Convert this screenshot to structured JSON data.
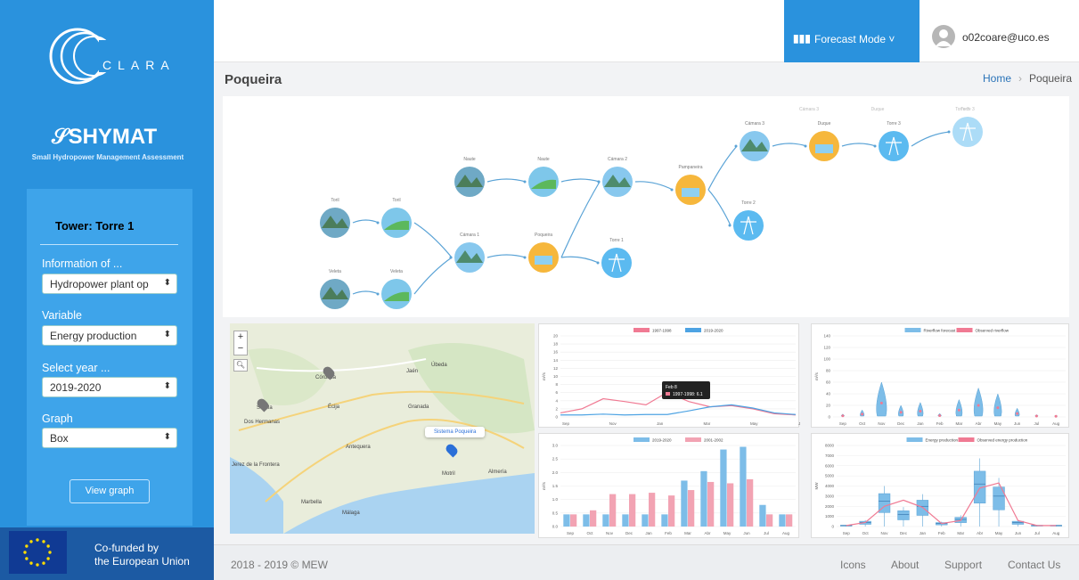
{
  "sidebar": {
    "logo_text": "CLARA",
    "brand": "SHYMAT",
    "brand_subtitle": "Small Hydropower Management Assessment",
    "tower_title": "Tower: Torre 1",
    "fields": [
      {
        "label": "Information of ...",
        "value": "Hydropower plant op"
      },
      {
        "label": "Variable",
        "value": "Energy production"
      },
      {
        "label": "Select year ...",
        "value": "2019-2020"
      },
      {
        "label": "Graph",
        "value": "Box"
      }
    ],
    "view_button": "View graph",
    "eu_line1": "Co-funded by",
    "eu_line2": "the European Union"
  },
  "topbar": {
    "forecast_icon": "bar-chart-icon",
    "forecast_label": "Forecast Mode",
    "forecast_caret": "˅",
    "user_email": "o02coare@uco.es"
  },
  "page": {
    "title": "Poqueira",
    "breadcrumb_home": "Home",
    "breadcrumb_current": "Poqueira"
  },
  "diagram_nodes": [
    {
      "label": "Toril",
      "kind": "mountain"
    },
    {
      "label": "Toril",
      "kind": "river"
    },
    {
      "label": "Veleta",
      "kind": "mountain"
    },
    {
      "label": "Veleta",
      "kind": "river"
    },
    {
      "label": "Cámara 1",
      "kind": "lake"
    },
    {
      "label": "Poqueira",
      "kind": "plant"
    },
    {
      "label": "Torre 1",
      "kind": "tower"
    },
    {
      "label": "Naute",
      "kind": "mountain"
    },
    {
      "label": "Naute",
      "kind": "river"
    },
    {
      "label": "Cámara 2",
      "kind": "lake"
    },
    {
      "label": "Pampaneira",
      "kind": "plant"
    },
    {
      "label": "Torre 2",
      "kind": "tower"
    },
    {
      "label": "Cámara 3",
      "kind": "lake"
    },
    {
      "label": "Duque",
      "kind": "plant"
    },
    {
      "label": "Torre 3",
      "kind": "tower"
    },
    {
      "label": "Torre 3",
      "kind": "tower"
    }
  ],
  "diagram_ghost_labels": [
    "Cámara 3",
    "Duque",
    "Torre 3"
  ],
  "map": {
    "popup": "Sistema Poqueira",
    "zoom_in": "+",
    "zoom_out": "−",
    "search_icon": "search-icon",
    "places": [
      "Córdoba",
      "Sevilla",
      "Jaén",
      "Granada",
      "Málaga",
      "Marbella",
      "Almería",
      "Écija",
      "Antequera",
      "Úbeda",
      "Dos Hermanas",
      "Jerez de la Frontera",
      "Motril"
    ]
  },
  "charts": {
    "line": {
      "legend": [
        "1997-1998",
        "2019-2020"
      ],
      "x": [
        "Sep",
        "Nov",
        "Jan",
        "Mar",
        "May",
        "Jul"
      ],
      "y_ticks": [
        "0",
        "2",
        "4",
        "6",
        "8",
        "10",
        "12",
        "14",
        "16",
        "18",
        "20"
      ],
      "ylabel": "m³/s",
      "tooltip_title": "Feb 8",
      "tooltip_value": "1997-1998: 6.1"
    },
    "bar": {
      "legend": [
        "2019-2020",
        "2001-2002"
      ],
      "x": [
        "Sep",
        "Oct",
        "Nov",
        "Dec",
        "Jan",
        "Feb",
        "Mar",
        "Abr",
        "May",
        "Jun",
        "Jul",
        "Aug"
      ],
      "y_ticks": [
        "0.0",
        "0.5",
        "1.0",
        "1.5",
        "2.0",
        "2.5",
        "3.0"
      ],
      "ylabel": "m³/s"
    },
    "violin": {
      "legend": [
        "Riverflow forecast",
        "Observed riverflow"
      ],
      "x": [
        "Sep",
        "Oct",
        "Nov",
        "Dec",
        "Jan",
        "Feb",
        "Mar",
        "Abr",
        "May",
        "Jun",
        "Jul",
        "Aug"
      ],
      "y_ticks": [
        "0",
        "20",
        "40",
        "60",
        "80",
        "100",
        "120",
        "140"
      ],
      "ylabel": "m³/s"
    },
    "box": {
      "legend": [
        "Energy production forecast",
        "Observed energy production"
      ],
      "x": [
        "Sep",
        "Oct",
        "Nov",
        "Dec",
        "Jan",
        "Feb",
        "Mar",
        "Abr",
        "May",
        "Jun",
        "Jul",
        "Aug"
      ],
      "y_ticks": [
        "0",
        "1000",
        "2000",
        "3000",
        "4000",
        "5000",
        "6000",
        "7000",
        "8000"
      ],
      "ylabel": "MW"
    }
  },
  "chart_data": [
    {
      "type": "line",
      "x": [
        "Sep",
        "Oct",
        "Nov",
        "Dec",
        "Jan",
        "Feb",
        "Mar",
        "Apr",
        "May",
        "Jun",
        "Jul",
        "Aug"
      ],
      "ylim": [
        0,
        20
      ],
      "series": [
        {
          "name": "1997-1998",
          "color": "#f07a93",
          "values": [
            1.0,
            2.0,
            4.5,
            3.8,
            3.0,
            6.1,
            3.8,
            2.5,
            2.8,
            2.0,
            0.8,
            0.5
          ]
        },
        {
          "name": "2019-2020",
          "color": "#4da3e3",
          "values": [
            0.5,
            0.5,
            0.7,
            0.5,
            0.6,
            0.6,
            1.5,
            2.5,
            3.0,
            2.2,
            1.0,
            0.6
          ]
        }
      ]
    },
    {
      "type": "bar",
      "categories": [
        "Sep",
        "Oct",
        "Nov",
        "Dec",
        "Jan",
        "Feb",
        "Mar",
        "Abr",
        "May",
        "Jun",
        "Jul",
        "Aug"
      ],
      "ylim": [
        0,
        3
      ],
      "series": [
        {
          "name": "2019-2020",
          "color": "#7dbde8",
          "values": [
            0.45,
            0.45,
            0.45,
            0.45,
            0.45,
            0.45,
            1.7,
            2.05,
            2.85,
            2.95,
            0.8,
            0.45
          ]
        },
        {
          "name": "2001-2002",
          "color": "#f2a3b3",
          "values": [
            0.45,
            0.6,
            1.2,
            1.2,
            1.25,
            1.15,
            1.35,
            1.65,
            1.6,
            1.75,
            0.45,
            0.45
          ]
        }
      ]
    },
    {
      "type": "violin",
      "categories": [
        "Sep",
        "Oct",
        "Nov",
        "Dec",
        "Jan",
        "Feb",
        "Mar",
        "Abr",
        "May",
        "Jun",
        "Jul",
        "Aug"
      ],
      "ylim": [
        0,
        140
      ],
      "series": [
        {
          "name": "Riverflow forecast",
          "color": "#7dbde8",
          "values": [
            5,
            12,
            60,
            20,
            25,
            6,
            30,
            50,
            40,
            15,
            4,
            3
          ]
        }
      ]
    },
    {
      "type": "box",
      "categories": [
        "Sep",
        "Oct",
        "Nov",
        "Dec",
        "Jan",
        "Feb",
        "Mar",
        "Abr",
        "May",
        "Jun",
        "Jul",
        "Aug"
      ],
      "ylim": [
        0,
        8000
      ],
      "series": [
        {
          "name": "Energy production forecast",
          "color": "#7dbde8",
          "values": [
            100,
            400,
            2500,
            1200,
            2000,
            300,
            700,
            4200,
            3000,
            400,
            100,
            100
          ]
        },
        {
          "name": "Observed energy production",
          "color": "#f07a93",
          "values": [
            100,
            400,
            2000,
            2600,
            1900,
            300,
            600,
            3800,
            4300,
            600,
            100,
            100
          ]
        }
      ]
    }
  ]
}
